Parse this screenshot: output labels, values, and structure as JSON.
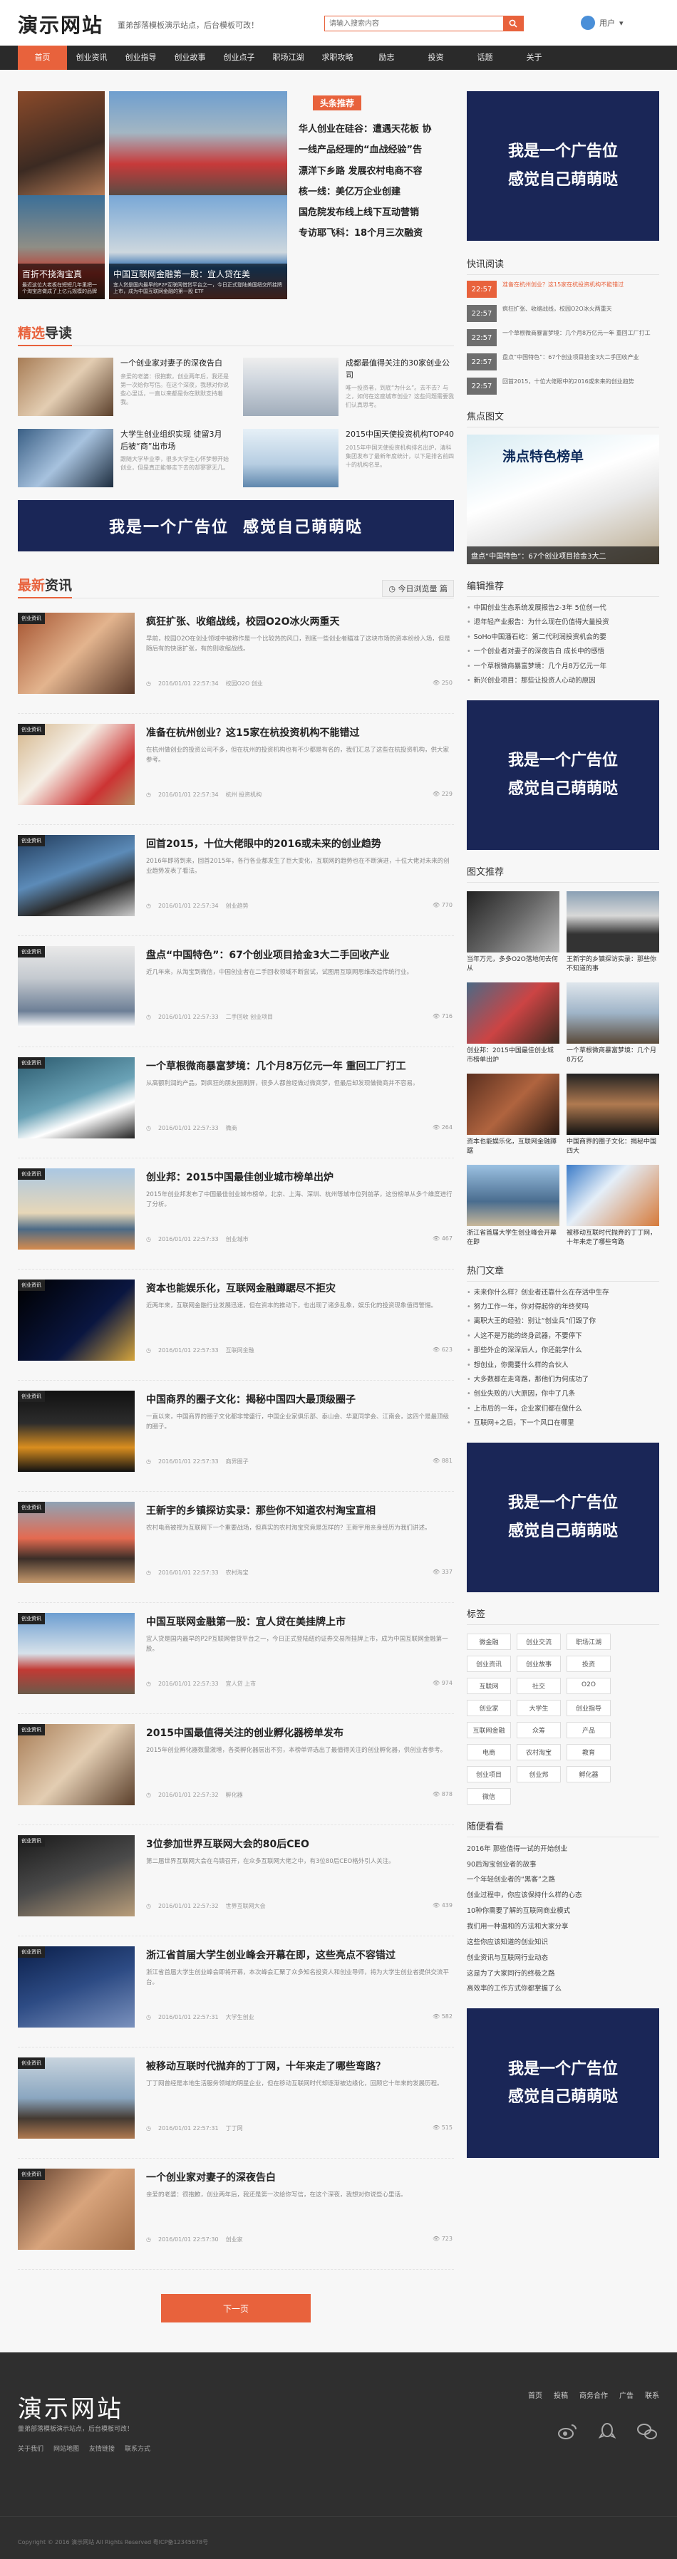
{
  "header": {
    "logo": "演示网站",
    "slogan": "董弟部落模板演示站点，后台模板可改！",
    "search_placeholder": "请输入搜索内容",
    "user_label": "用户"
  },
  "nav": [
    "首页",
    "创业资讯",
    "创业指导",
    "创业故事",
    "创业点子",
    "职场江湖",
    "求职攻略",
    "励志",
    "投资",
    "话题",
    "关于"
  ],
  "slides": [
    {
      "title": "百折不挠淘宝真",
      "desc": "最近这位大老板在短短几年里把一个淘宝店做成了上亿元规模的品牌"
    },
    {
      "title": "中国互联网金融第一股：宜人贷在美",
      "desc": "宜人贷是国内最早的P2P互联网借贷平台之一，今日正式登陆美国纽交所挂牌上市，成为中国互联网金融的第一股 ETF"
    }
  ],
  "headlines": {
    "tag": "头条推荐",
    "items": [
      "华人创业在硅谷：遭遇天花板 协",
      "一线产品经理的“血战经验”告",
      "漂洋下乡路 发展农村电商不容",
      "核一线：美亿万企业创建",
      "国危院发布线上线下互动营销",
      "专访耶飞科：18个月三次融资"
    ]
  },
  "picks": {
    "title_a": "精选",
    "title_b": "导读",
    "items": [
      {
        "title": "一个创业家对妻子的深夜告白",
        "desc": "亲爱的老婆：很抱歉，创业两年后，我还是第一次给你写信。在这个深夜，我想对你说些心里话，一直以来都是你在默默支持着我。"
      },
      {
        "title": "成都最值得关注的30家创业公司",
        "desc": "唯一投资者，到底“为什么”。去不去？与之，如何在这座城市创业？这些问题需要我们认真思考。"
      },
      {
        "title": "大学生创业组织实现 徒留3月后被“商”出市场",
        "desc": "跟随大学毕业季，很多大学生心怀梦想开始创业，但是真正能够走下去的却寥寥无几。"
      },
      {
        "title": "2015中国天使投资机构TOP40",
        "desc": "2015年中国天使投资机构排名出炉，清科集团发布了最新年度统计，以下是排名前四十的机构名单。"
      }
    ]
  },
  "ad_text": [
    "我是一个广告位",
    "感觉自己萌萌哒"
  ],
  "latest": {
    "title_a": "最新",
    "title_b": "资讯",
    "today_label": "今日浏览量",
    "today_value": "篇",
    "badge": "创业资讯",
    "items": [
      {
        "title": "疯狂扩张、收缩战线，校园O2O冰火两重天",
        "excerpt": "早前，校园O2O在创业领域中被称作是一个比较热的风口，到底一些创业者瞄准了这块市场的资本纷纷入场，但是随后有的快速扩张，有的则收缩战线。",
        "date": "2016/01/01 22:57:34",
        "category": "校园O2O 创业",
        "views": "250"
      },
      {
        "title": "准备在杭州创业？这15家在杭投资机构不能错过",
        "excerpt": "在杭州做创业的投资公司不多，但在杭州的投资机构也有不少都是有名的，我们汇总了这些在杭投资机构，供大家参考。",
        "date": "2016/01/01 22:57:34",
        "category": "杭州 投资机构",
        "views": "229"
      },
      {
        "title": "回首2015，十位大佬眼中的2016或未来的创业趋势",
        "excerpt": "2016年即将到来，回首2015年，各行各业都发生了巨大变化，互联网的趋势也在不断演进，十位大佬对未来的创业趋势发表了看法。",
        "date": "2016/01/01 22:57:34",
        "category": "创业趋势",
        "views": "770"
      },
      {
        "title": "盘点“中国特色”：67个创业项目拾金3大二手回收产业",
        "excerpt": "近几年来，从淘宝到微信，中国创业者在二手回收领域不断尝试，试图用互联网思维改造传统行业。",
        "date": "2016/01/01 22:57:33",
        "category": "二手回收 创业项目",
        "views": "716"
      },
      {
        "title": "一个草根微商暴富梦境：几个月8万亿元一年 重回工厂打工",
        "excerpt": "从高额利润的产品，到疯狂的朋友圈刷屏，很多人都曾经做过微商梦，但最后却发现做微商并不容易。",
        "date": "2016/01/01 22:57:33",
        "category": "微商",
        "views": "264"
      },
      {
        "title": "创业邦：2015中国最佳创业城市榜单出炉",
        "excerpt": "2015年创业邦发布了中国最佳创业城市榜单，北京、上海、深圳、杭州等城市位列前茅，这份榜单从多个维度进行了分析。",
        "date": "2016/01/01 22:57:33",
        "category": "创业城市",
        "views": "467"
      },
      {
        "title": "资本也能娱乐化，互联网金融蹲踞尽不拒灾",
        "excerpt": "近两年来，互联网金融行业发展迅速，但在资本的推动下，也出现了诸多乱象，娱乐化的投资现象值得警惕。",
        "date": "2016/01/01 22:57:33",
        "category": "互联网金融",
        "views": "623"
      },
      {
        "title": "中国商界的圈子文化：揭秘中国四大最顶级圈子",
        "excerpt": "一直以来，中国商界的圈子文化都非常盛行，中国企业家俱乐部、泰山会、华夏同学会、江南会，这四个是最顶级的圈子。",
        "date": "2016/01/01 22:57:33",
        "category": "商界圈子",
        "views": "881"
      },
      {
        "title": "王新宇的乡镇探访实录：那些你不知道农村淘宝直相",
        "excerpt": "农村电商被视为互联网下一个重要战场，但真实的农村淘宝究竟是怎样的？王新宇用亲身经历为我们讲述。",
        "date": "2016/01/01 22:57:33",
        "category": "农村淘宝",
        "views": "337"
      },
      {
        "title": "中国互联网金融第一股：宜人贷在美挂牌上市",
        "excerpt": "宜人贷是国内最早的P2P互联网借贷平台之一，今日正式登陆纽约证券交易所挂牌上市，成为中国互联网金融第一股。",
        "date": "2016/01/01 22:57:33",
        "category": "宜人贷 上市",
        "views": "974"
      },
      {
        "title": "2015中国最值得关注的创业孵化器榜单发布",
        "excerpt": "2015年创业孵化器数量激增，各类孵化器层出不穷，本榜单评选出了最值得关注的创业孵化器，供创业者参考。",
        "date": "2016/01/01 22:57:32",
        "category": "孵化器",
        "views": "878"
      },
      {
        "title": "3位参加世界互联网大会的80后CEO",
        "excerpt": "第二届世界互联网大会在乌镇召开，在众多互联网大佬之中，有3位80后CEO格外引人关注。",
        "date": "2016/01/01 22:57:32",
        "category": "世界互联网大会",
        "views": "439"
      },
      {
        "title": "浙江省首届大学生创业峰会开幕在即，这些亮点不容错过",
        "excerpt": "浙江省首届大学生创业峰会即将开幕，本次峰会汇聚了众多知名投资人和创业导师，将为大学生创业者提供交流平台。",
        "date": "2016/01/01 22:57:31",
        "category": "大学生创业",
        "views": "582"
      },
      {
        "title": "被移动互联时代抛弃的丁丁网，十年来走了哪些弯路？",
        "excerpt": "丁丁网曾经是本地生活服务领域的明星企业，但在移动互联网时代却逐渐被边缘化，回顾它十年来的发展历程。",
        "date": "2016/01/01 22:57:31",
        "category": "丁丁网",
        "views": "515"
      },
      {
        "title": "一个创业家对妻子的深夜告白",
        "excerpt": "亲爱的老婆：很抱歉，创业两年后，我还是第一次给你写信，在这个深夜，我想对你说些心里话。",
        "date": "2016/01/01 22:57:30",
        "category": "创业家",
        "views": "723"
      }
    ],
    "more_label": "下一页"
  },
  "sidebar": {
    "flash_title": "快讯阅读",
    "flash": [
      {
        "time": "22:57",
        "text": "准备在杭州创业？这15家在杭投资机构不能错过",
        "hot": true
      },
      {
        "time": "22:57",
        "text": "疯狂扩张、收缩战线，校园O2O冰火两重天",
        "hot": false
      },
      {
        "time": "22:57",
        "text": "一个草根微商暴富梦境：几个月8万亿元一年 重回工厂打工",
        "hot": false
      },
      {
        "time": "22:57",
        "text": "盘点“中国特色”：67个创业项目拾金3大二手回收产业",
        "hot": false
      },
      {
        "time": "22:57",
        "text": "回首2015，十位大佬眼中的2016或未来的创业趋势",
        "hot": false
      }
    ],
    "focus_title": "焦点图文",
    "focus_big": "沸点特色榜单",
    "focus_caption": "盘点“中国特色”：67个创业项目拾金3大二",
    "editor_title": "编辑推荐",
    "editor": [
      "中国创业生态系统发展报告2-3年 5位创一代",
      "退年轻产业报告：为什么现在仍值得大量投资",
      "SoHo中国潘石屹：第二代利润投资机会的要",
      "一个创业者对妻子的深夜告白 成长中的感悟",
      "一个草根微商暴富梦境：几个月8万亿元一年",
      "新兴创业项目：那些让投资人心动的原因"
    ],
    "pics_title": "图文推荐",
    "pics": [
      "当年万元，多多O2O落地何去何从",
      "王新宇的乡镇探访实录：那些你不知道的事",
      "创业邦：2015中国最佳创业城市榜单出炉",
      "一个草根微商暴富梦境：几个月8万亿",
      "资本也能娱乐化，互联网金融蹲踞",
      "中国商界的圈子文化：揭秘中国四大",
      "浙江省首届大学生创业峰会开幕在即",
      "被移动互联时代抛弃的丁丁网，十年来走了哪些弯路"
    ],
    "hot_title": "热门文章",
    "hot": [
      "未来你什么样？创业者还靠什么在存活中生存",
      "努力工作一年，你对得起你的年终奖吗",
      "离职大王的经验：别让“创业兵”们毁了你",
      "人这不是万能的终身武器，不要停下",
      "那些外企的深深后人，你还能学什么",
      "想创业，你需要什么样的合伙人",
      "大多数都在走弯路，那他们为何成功了",
      "创业失败的八大原因，你中了几条",
      "上市后的一年，企业家们都在做什么",
      "互联网+之后，下一个风口在哪里"
    ],
    "tags_title": "标签",
    "tags": [
      "微金融",
      "创业交流",
      "职场江湖",
      "创业资讯",
      "创业故事",
      "投资",
      "互联网",
      "社交",
      "O2O",
      "创业家",
      "大学生",
      "创业指导",
      "互联网金融",
      "众筹",
      "产品",
      "电商",
      "农村淘宝",
      "教育",
      "创业项目",
      "创业邦",
      "孵化器",
      "微信"
    ],
    "random_title": "随便看看",
    "random": [
      "2016年 那些值得一试的开始创业",
      "90后淘宝创业者的故事",
      "一个年轻创业者的“黑客”之路",
      "创业过程中，你应该保持什么样的心态",
      "10种你需要了解的互联网商业模式",
      "我们用一种温和的方法和大家分享",
      "这些你应该知道的创业知识",
      "创业资讯与互联网行业动态",
      "这是为了大家同行的终极之路",
      "高效率的工作方式你都掌握了么"
    ]
  },
  "footer": {
    "logo": "演示网站",
    "desc": "董弟部落模板演示站点，后台模板可改！",
    "links": [
      "关于我们",
      "网站地图",
      "友情链接",
      "联系方式"
    ],
    "nav": [
      "首页",
      "投稿",
      "商务合作",
      "广告",
      "联系"
    ],
    "copyright": "Copyright © 2016 演示网站 All Rights Reserved 粤ICP备12345678号"
  }
}
